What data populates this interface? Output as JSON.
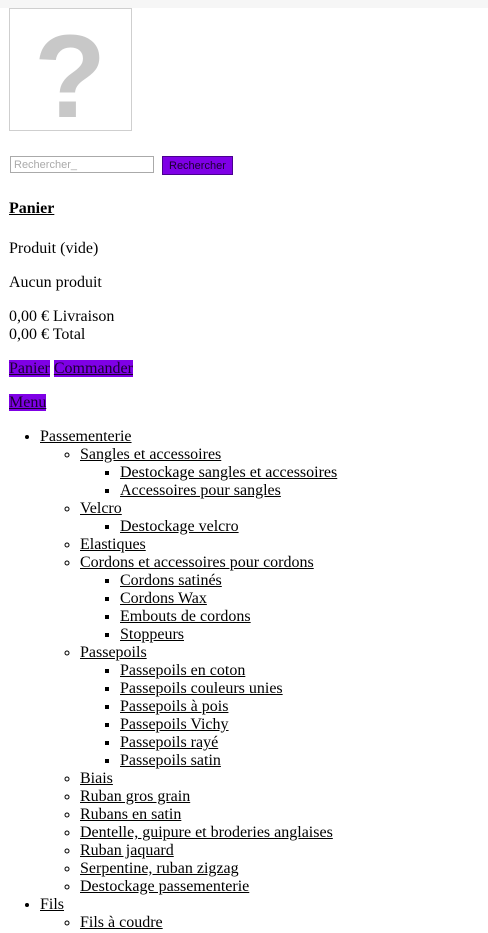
{
  "search": {
    "placeholder": "Rechercher_",
    "button_label": "Rechercher"
  },
  "cart": {
    "title": "Panier",
    "products_line": "Produit (vide)",
    "empty_line": "Aucun produit",
    "shipping_line": "0,00 € Livraison",
    "total_line": "0,00 € Total",
    "cart_link": "Panier",
    "order_link": "Commander"
  },
  "menu": {
    "toggle_label": "Menu",
    "items": [
      {
        "label": "Passementerie",
        "children": [
          {
            "label": "Sangles et accessoires",
            "children": [
              {
                "label": "Destockage sangles et accessoires"
              },
              {
                "label": "Accessoires pour sangles"
              }
            ]
          },
          {
            "label": "Velcro",
            "children": [
              {
                "label": "Destockage velcro"
              }
            ]
          },
          {
            "label": "Elastiques"
          },
          {
            "label": "Cordons et accessoires pour cordons",
            "children": [
              {
                "label": "Cordons satinés"
              },
              {
                "label": "Cordons Wax"
              },
              {
                "label": "Embouts de cordons"
              },
              {
                "label": "Stoppeurs"
              }
            ]
          },
          {
            "label": "Passepoils",
            "children": [
              {
                "label": "Passepoils en coton"
              },
              {
                "label": "Passepoils couleurs unies"
              },
              {
                "label": "Passepoils à pois"
              },
              {
                "label": "Passepoils Vichy"
              },
              {
                "label": "Passepoils rayé"
              },
              {
                "label": "Passepoils satin"
              }
            ]
          },
          {
            "label": "Biais"
          },
          {
            "label": "Ruban gros grain"
          },
          {
            "label": "Rubans en satin"
          },
          {
            "label": "Dentelle, guipure et broderies anglaises"
          },
          {
            "label": "Ruban jaquard"
          },
          {
            "label": "Serpentine, ruban zigzag"
          },
          {
            "label": "Destockage passementerie"
          }
        ]
      },
      {
        "label": "Fils",
        "children": [
          {
            "label": "Fils à coudre"
          }
        ]
      }
    ]
  }
}
